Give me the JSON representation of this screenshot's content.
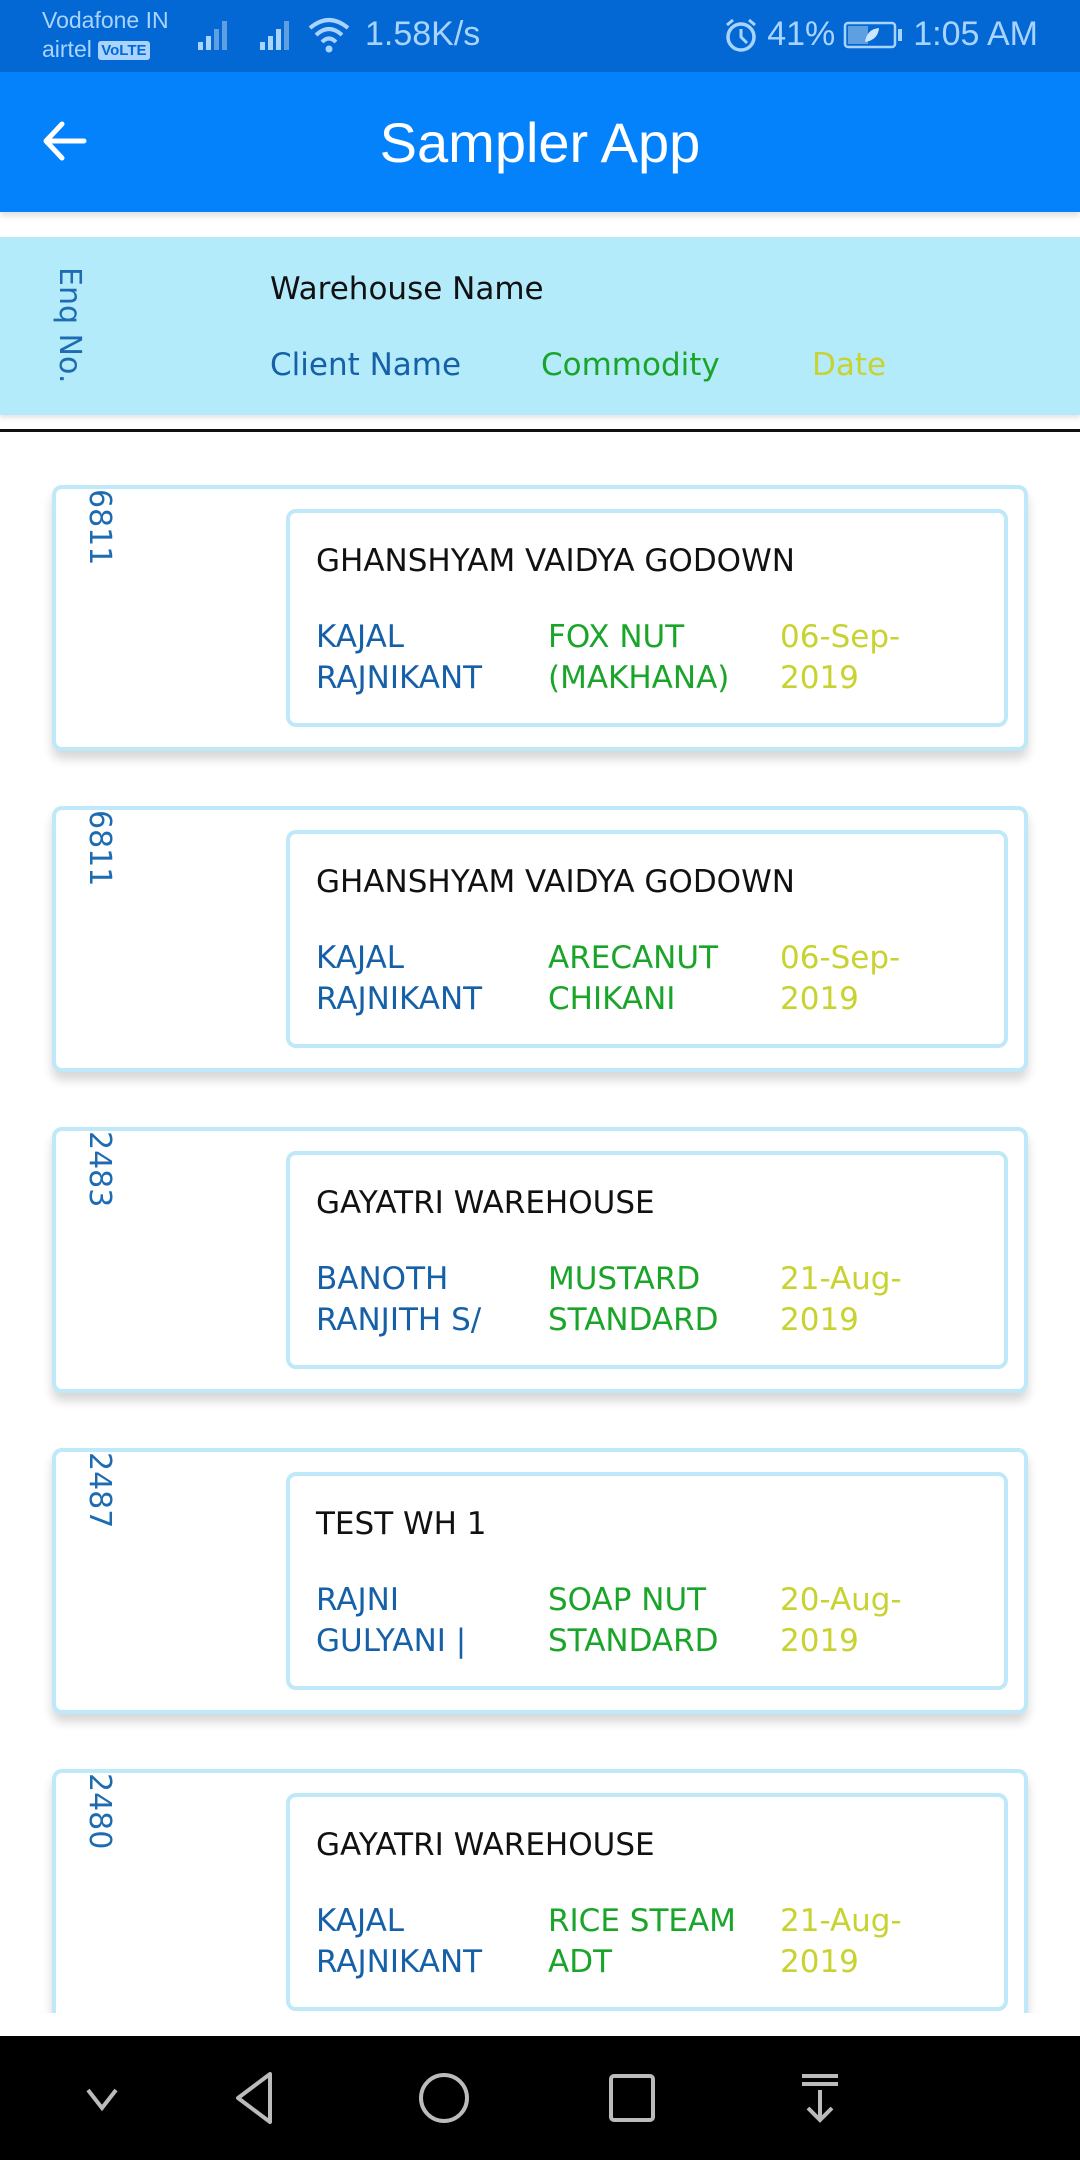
{
  "status_bar": {
    "carrier_1": "Vodafone IN",
    "carrier_2": "airtel",
    "volte_badge": "VoLTE",
    "network_speed": "1.58K/s",
    "battery_percent": "41%",
    "time": "1:05 AM",
    "icons": [
      "signal-icon",
      "signal-icon",
      "wifi-icon",
      "alarm-icon",
      "battery-icon"
    ]
  },
  "app_bar": {
    "title": "Sampler App",
    "back_icon": "arrow-left-icon"
  },
  "header": {
    "enq_no": "Enq No.",
    "warehouse_name": "Warehouse Name",
    "client_name": "Client Name",
    "commodity": "Commodity",
    "date": "Date"
  },
  "colors": {
    "status_bar": "#0468d4",
    "app_bar": "#0382fc",
    "header_band": "#b3ebfb",
    "card_border": "#bfe9f8",
    "client_text": "#1660a8",
    "commodity_text": "#1aa52a",
    "date_text": "#c8d230"
  },
  "records": [
    {
      "enq_no": "6811",
      "warehouse": "GHANSHYAM VAIDYA GODOWN",
      "client": "KAJAL\nRAJNIKANT",
      "commodity": "FOX NUT\n(MAKHANA)",
      "date": "06-Sep-\n2019"
    },
    {
      "enq_no": "6811",
      "warehouse": "GHANSHYAM VAIDYA GODOWN",
      "client": "KAJAL\nRAJNIKANT",
      "commodity": "ARECANUT\nCHIKANI",
      "date": "06-Sep-\n2019"
    },
    {
      "enq_no": "2483",
      "warehouse": "GAYATRI WAREHOUSE",
      "client": "BANOTH\nRANJITH S/",
      "commodity": "MUSTARD\nSTANDARD",
      "date": "21-Aug-\n2019"
    },
    {
      "enq_no": "2487",
      "warehouse": "TEST WH 1",
      "client": "RAJNI\nGULYANI |",
      "commodity": "SOAP NUT\nSTANDARD",
      "date": "20-Aug-\n2019"
    },
    {
      "enq_no": "2480",
      "warehouse": "GAYATRI WAREHOUSE",
      "client": "KAJAL\nRAJNIKANT",
      "commodity": "RICE STEAM\nADT",
      "date": "21-Aug-\n2019"
    }
  ],
  "nav_bar": {
    "buttons": [
      "chevron-down-icon",
      "back-triangle-icon",
      "home-circle-icon",
      "recents-square-icon",
      "notification-pull-icon"
    ]
  }
}
